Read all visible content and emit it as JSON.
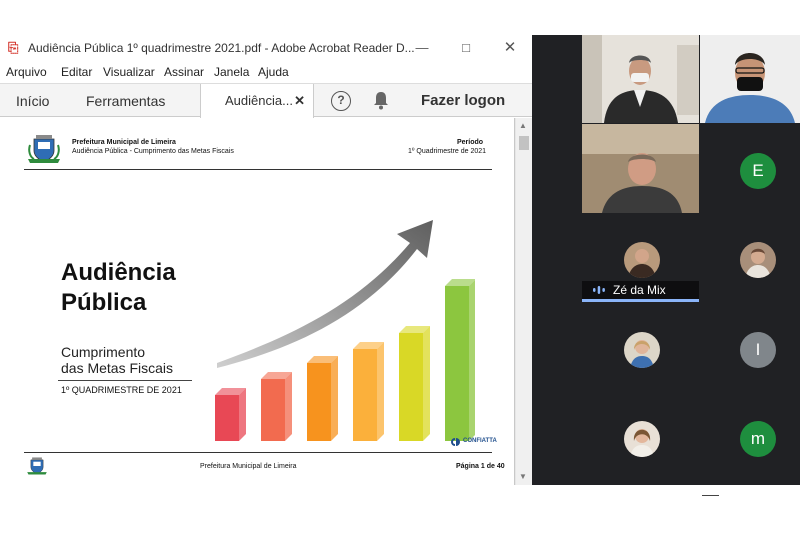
{
  "acrobat": {
    "window_title": "Audiência Pública 1º quadrimestre 2021.pdf - Adobe Acrobat Reader D...",
    "menu": [
      "Arquivo",
      "Editar",
      "Visualizar",
      "Assinar",
      "Janela",
      "Ajuda"
    ],
    "tabs": {
      "home": "Início",
      "tools": "Ferramentas",
      "document": "Audiência..."
    },
    "logon_label": "Fazer logon",
    "help_label": "?"
  },
  "pdf_page": {
    "org_name": "Prefeitura Municipal de Limeira",
    "doc_subtitle": "Audiência Pública - Cumprimento das Metas Fiscais",
    "period_label": "Período",
    "period_value": "1º Quadrimestre de 2021",
    "title_line1": "Audiência",
    "title_line2": "Pública",
    "subtitle_line1": "Cumprimento",
    "subtitle_line2": "das Metas Fiscais",
    "quadrimester": "1º QUADRIMESTRE DE 2021",
    "footer_org": "Prefeitura Municipal de Limeira",
    "page_indicator": "Página 1 de 40",
    "brand_logo_text": "CONFIATTA",
    "bar_colors": [
      "#e84855",
      "#f26b4f",
      "#f7931e",
      "#fbb03b",
      "#d9d826",
      "#8cc63f"
    ]
  },
  "meeting": {
    "active_speaker_name": "Zé da Mix",
    "participants_initials": [
      "E",
      "I",
      "m"
    ],
    "initial_colors": {
      "E": "#1e8e3e",
      "I": "#80868b",
      "m": "#1e8e3e"
    },
    "speaking_color": "#8ab4f8"
  }
}
